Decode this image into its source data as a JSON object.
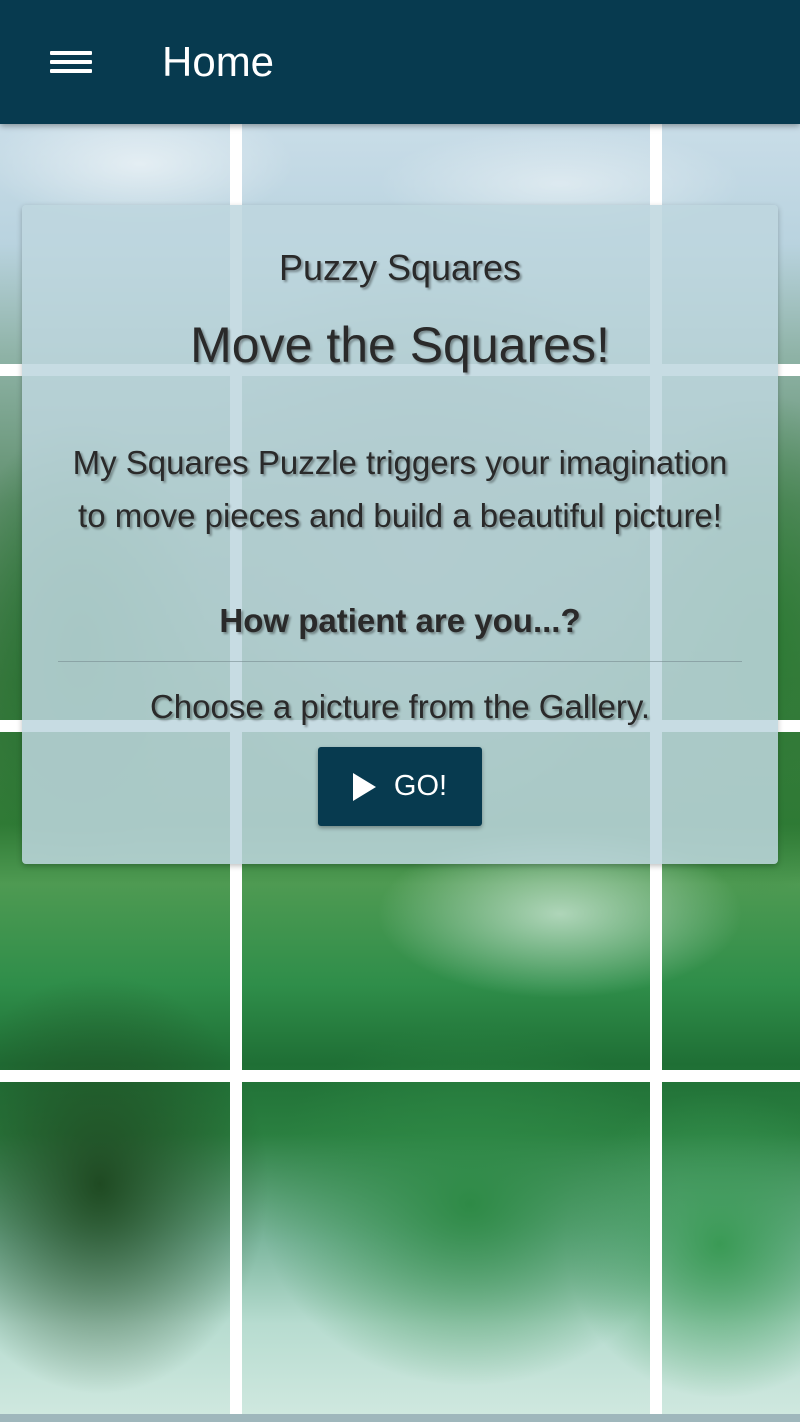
{
  "header": {
    "title": "Home",
    "menu_icon": "hamburger-menu-icon",
    "background_color": "#073a4f"
  },
  "card": {
    "app_name": "Puzzy Squares",
    "headline": "Move the Squares!",
    "description": "My Squares Puzzle triggers your imagination to move pieces and build a beautiful picture!",
    "question": "How patient are you...?",
    "instruction": "Choose a picture from the Gallery.",
    "go_button": {
      "label": "GO!",
      "icon": "play-icon"
    }
  },
  "colors": {
    "primary": "#073a4f",
    "card_background": "#bed6de",
    "text": "#2a2a2a"
  }
}
